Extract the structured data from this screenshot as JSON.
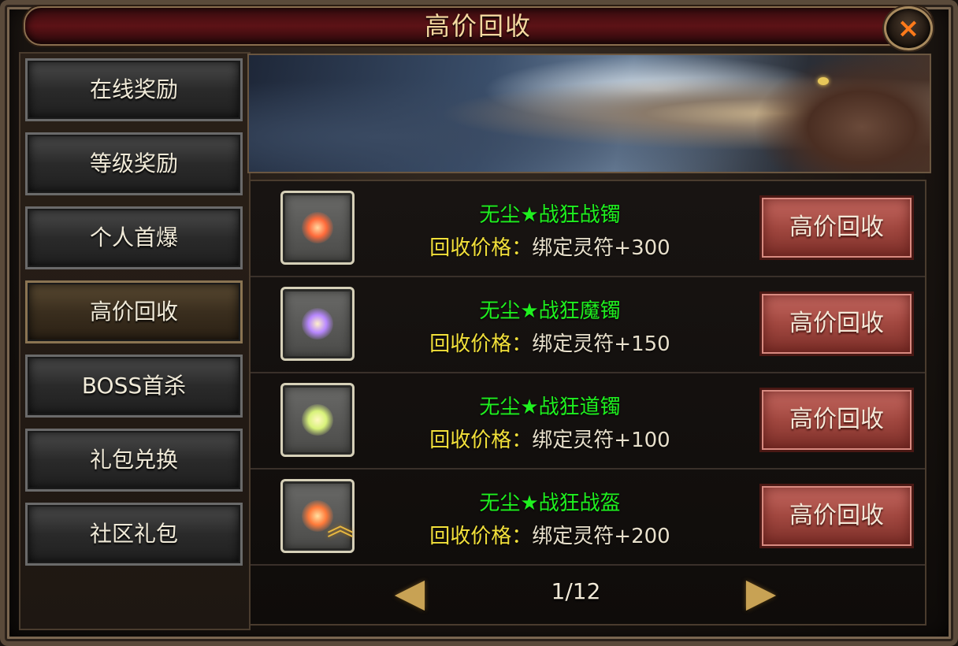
{
  "window": {
    "title": "高价回收",
    "close_icon": "×"
  },
  "sidebar": {
    "items": [
      {
        "label": "在线奖励",
        "active": false
      },
      {
        "label": "等级奖励",
        "active": false
      },
      {
        "label": "个人首爆",
        "active": false
      },
      {
        "label": "高价回收",
        "active": true
      },
      {
        "label": "BOSS首杀",
        "active": false
      },
      {
        "label": "礼包兑换",
        "active": false
      },
      {
        "label": "社区礼包",
        "active": false
      }
    ]
  },
  "list": {
    "items": [
      {
        "name": "无尘★战狂战镯",
        "price_label": "回收价格：",
        "price_value": "绑定灵符+300",
        "button": "高价回收",
        "icon": "bracelet-icon",
        "glow": "#ff6a3a"
      },
      {
        "name": "无尘★战狂魔镯",
        "price_label": "回收价格：",
        "price_value": "绑定灵符+150",
        "button": "高价回收",
        "icon": "bracelet-icon",
        "glow": "#b888ff"
      },
      {
        "name": "无尘★战狂道镯",
        "price_label": "回收价格：",
        "price_value": "绑定灵符+100",
        "button": "高价回收",
        "icon": "bracelet-icon",
        "glow": "#d8f27a"
      },
      {
        "name": "无尘★战狂战盔",
        "price_label": "回收价格：",
        "price_value": "绑定灵符+200",
        "button": "高价回收",
        "icon": "helmet-icon",
        "glow": "#ff7a3a"
      }
    ]
  },
  "pager": {
    "current": "1/12",
    "prev_icon": "◀",
    "next_icon": "▶",
    "scroll_icon": "︽"
  }
}
